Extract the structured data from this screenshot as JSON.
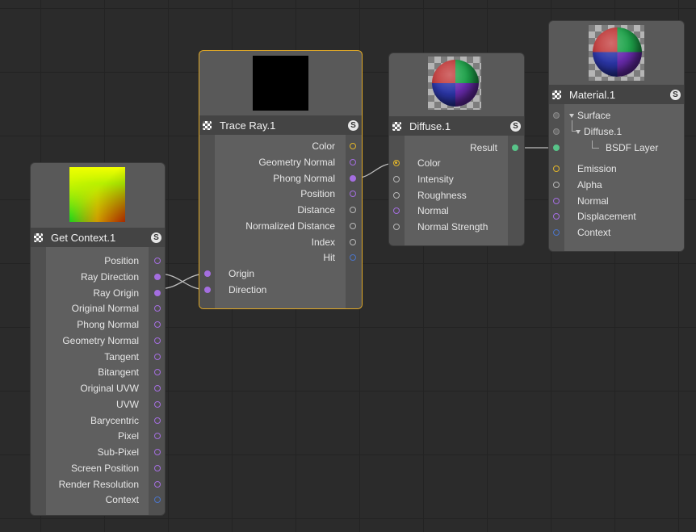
{
  "nodes": {
    "get_context": {
      "title": "Get Context.1",
      "badge": "S",
      "outputs": [
        "Position",
        "Ray Direction",
        "Ray Origin",
        "Original Normal",
        "Phong Normal",
        "Geometry Normal",
        "Tangent",
        "Bitangent",
        "Original UVW",
        "UVW",
        "Barycentric",
        "Pixel",
        "Sub-Pixel",
        "Screen Position",
        "Render Resolution",
        "Context"
      ]
    },
    "trace_ray": {
      "title": "Trace Ray.1",
      "badge": "S",
      "outputs": [
        "Color",
        "Geometry Normal",
        "Phong Normal",
        "Position",
        "Distance",
        "Normalized Distance",
        "Index",
        "Hit"
      ],
      "inputs": [
        "Origin",
        "Direction"
      ]
    },
    "diffuse": {
      "title": "Diffuse.1",
      "badge": "S",
      "outputs": [
        "Result"
      ],
      "inputs": [
        "Color",
        "Intensity",
        "Roughness",
        "Normal",
        "Normal Strength"
      ]
    },
    "material": {
      "title": "Material.1",
      "badge": "S",
      "tree": [
        "Surface",
        "Diffuse.1",
        "BSDF Layer"
      ],
      "inputs": [
        "Emission",
        "Alpha",
        "Normal",
        "Displacement",
        "Context"
      ]
    }
  },
  "colors": {
    "background": "#2b2b2b",
    "selection": "#e0a826",
    "port_purple": "#a46ee0",
    "port_yellow": "#e2b52a",
    "port_blue": "#4b74c8",
    "port_green": "#58c489"
  }
}
